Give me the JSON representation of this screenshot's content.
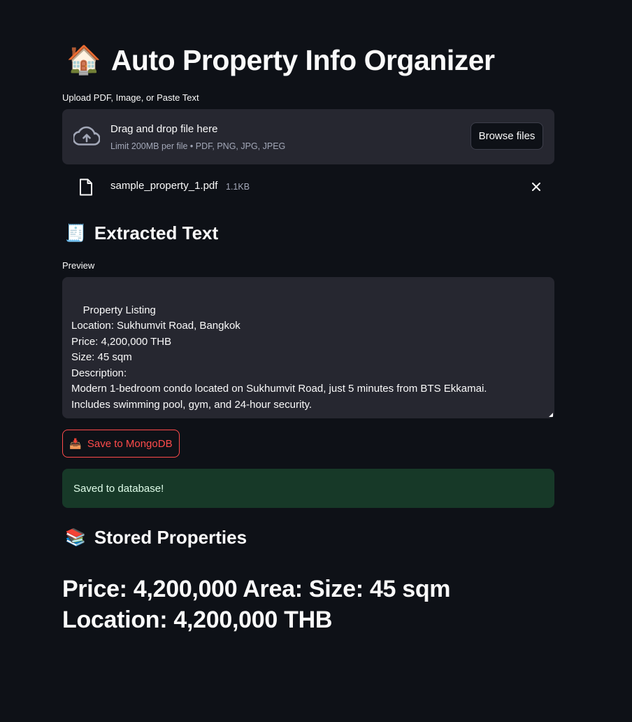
{
  "header": {
    "emoji": "🏠",
    "title": "Auto Property Info Organizer"
  },
  "uploader": {
    "label": "Upload PDF, Image, or Paste Text",
    "drag_text": "Drag and drop file here",
    "limit_text": "Limit 200MB per file • PDF, PNG, JPG, JPEG",
    "browse_label": "Browse files",
    "icons": {
      "upload": "cloud-upload-icon",
      "file": "file-icon",
      "remove": "close-icon"
    }
  },
  "file": {
    "name": "sample_property_1.pdf",
    "size": "1.1KB"
  },
  "extracted": {
    "emoji": "🧾",
    "heading": "Extracted Text",
    "preview_label": "Preview",
    "text": "Property Listing\nLocation: Sukhumvit Road, Bangkok\nPrice: 4,200,000 THB\nSize: 45 sqm\nDescription:\nModern 1-bedroom condo located on Sukhumvit Road, just 5 minutes from BTS Ekkamai.\nIncludes swimming pool, gym, and 24-hour security."
  },
  "save": {
    "emoji": "📥",
    "label": "Save to MongoDB"
  },
  "status": {
    "message": "Saved to database!"
  },
  "stored": {
    "emoji": "📚",
    "heading": "Stored Properties",
    "entry": "Price: 4,200,000 Area: Size: 45 sqm Location: 4,200,000 THB"
  },
  "colors": {
    "background": "#0e1117",
    "surface": "#262730",
    "accent": "#ff4b4b",
    "success_bg": "#173928",
    "success_text": "#dffde9"
  }
}
